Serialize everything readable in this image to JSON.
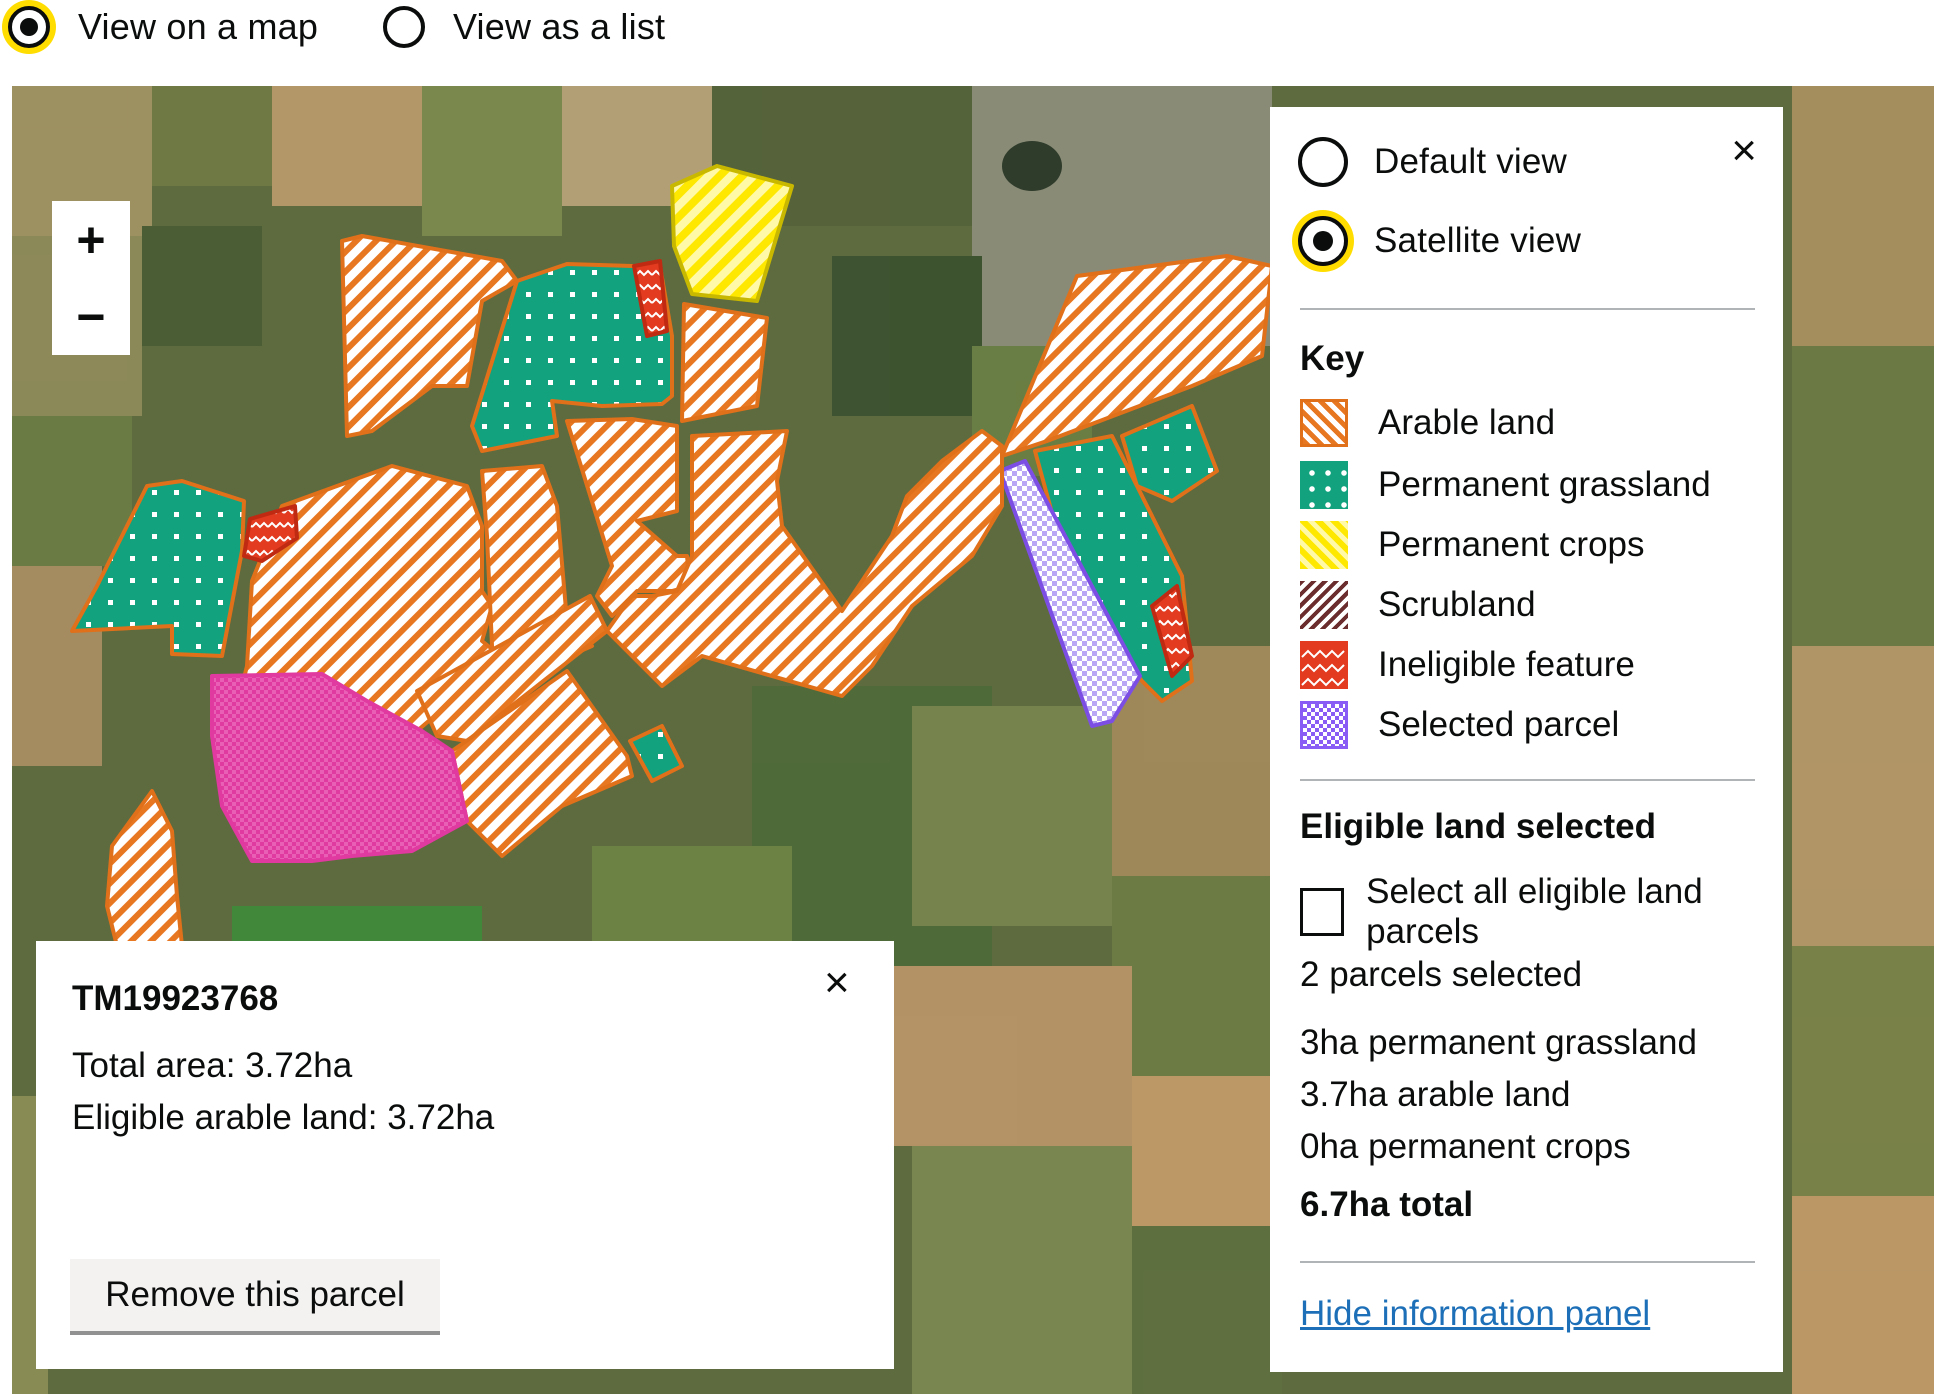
{
  "view_toggle": {
    "map_label": "View on a map",
    "list_label": "View as a list",
    "selected": "map"
  },
  "map": {
    "zoom_in": "+",
    "zoom_out": "−"
  },
  "info_panel": {
    "close_icon": "×",
    "view_options": [
      {
        "label": "Default view",
        "checked": false
      },
      {
        "label": "Satellite view",
        "checked": true
      }
    ],
    "key_title": "Key",
    "key_items": [
      {
        "label": "Arable land",
        "color": "#e87722"
      },
      {
        "label": "Permanent grassland",
        "color": "#12a37e"
      },
      {
        "label": "Permanent crops",
        "color": "#ffea00"
      },
      {
        "label": "Scrubland",
        "color": "#6b2d2d"
      },
      {
        "label": "Ineligible feature",
        "color": "#e63a1f"
      },
      {
        "label": "Selected parcel",
        "color": "#8a5cf6"
      }
    ],
    "eligible_title": "Eligible land selected",
    "select_all_label": "Select all eligible land parcels",
    "select_all_checked": false,
    "parcels_selected": "2 parcels selected",
    "summary_lines": [
      "3ha permanent grassland",
      "3.7ha arable land",
      "0ha permanent crops"
    ],
    "total": "6.7ha total",
    "hide_link": "Hide information panel"
  },
  "parcel_popup": {
    "close_icon": "×",
    "parcel_id": "TM19923768",
    "total_area": "Total area: 3.72ha",
    "eligible_arable": "Eligible arable land: 3.72ha",
    "remove_button": "Remove this parcel"
  },
  "colors": {
    "focus_yellow": "#ffdd00",
    "link_blue": "#1d70b8",
    "arable_stroke": "#e0701a",
    "grassland_fill": "#12a37e",
    "selected_magenta": "#e0399f"
  }
}
